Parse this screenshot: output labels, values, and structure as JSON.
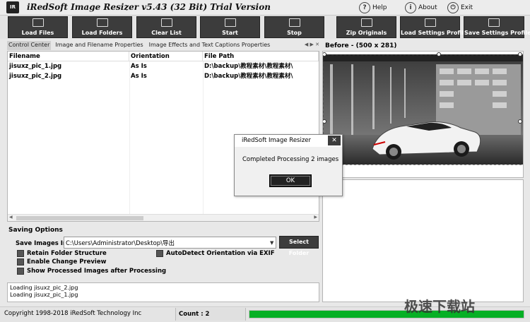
{
  "window": {
    "title": "iRedSoft Image Resizer v5.43 (32 Bit) Trial Version",
    "help": "Help",
    "about": "About",
    "exit": "Exit"
  },
  "toolbar": [
    {
      "label": "Load Files",
      "icon": "image-icon"
    },
    {
      "label": "Load Folders",
      "icon": "folder-icon"
    },
    {
      "label": "Clear List",
      "icon": "clear-icon"
    },
    {
      "label": "Start",
      "icon": "play-icon"
    },
    {
      "label": "Stop",
      "icon": "stop-icon"
    },
    {
      "label": "Zip Originals",
      "icon": "zip-icon"
    },
    {
      "label": "Load Settings Profile",
      "icon": "load-settings-icon"
    },
    {
      "label": "Save Settings Profile",
      "icon": "save-settings-icon"
    }
  ],
  "tabs": [
    "Control Center",
    "Image and Filename Properties",
    "Image Effects and Text Captions Properties"
  ],
  "table": {
    "columns": [
      "Filename",
      "Orientation",
      "File Path"
    ],
    "rows": [
      [
        "jisuxz_pic_1.jpg",
        "As Is",
        "D:\\backup\\教程素材\\教程素材\\"
      ],
      [
        "jisuxz_pic_2.jpg",
        "As Is",
        "D:\\backup\\教程素材\\教程素材\\"
      ]
    ]
  },
  "saving": {
    "title": "Saving Options",
    "save_label": "Save Images In",
    "save_path": "C:\\Users\\Administrator\\Desktop\\导出",
    "select_folder": "Select Folder",
    "retain_structure": "Retain Folder Structure",
    "enable_preview": "Enable Change Preview",
    "show_processed": "Show Processed Images after Processing",
    "autodetect": "AutoDetect Orientation via EXIF"
  },
  "log": [
    "Loading jisuxz_pic_2.jpg",
    "Loading jisuxz_pic_1.jpg"
  ],
  "status": {
    "copyright": "Copyright 1998-2018 iRedSoft Technology Inc",
    "count": "Count : 2",
    "progress": 1.0
  },
  "preview": {
    "before_label": "Before - (500 x 281)"
  },
  "dialog": {
    "title": "iRedSoft Image Resizer",
    "message": "Completed Processing 2 images",
    "ok": "OK",
    "close": "✕"
  },
  "watermark": "极速下载站"
}
